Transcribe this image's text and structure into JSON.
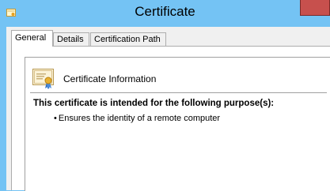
{
  "window": {
    "title": "Certificate",
    "app_icon": "certificate-app-icon",
    "close_icon": "close-icon",
    "colors": {
      "titlebar": "#74c3f4",
      "close": "#c7504d"
    }
  },
  "tabs": [
    {
      "label": "General",
      "active": true
    },
    {
      "label": "Details",
      "active": false
    },
    {
      "label": "Certification Path",
      "active": false
    }
  ],
  "general": {
    "icon": "certificate-icon",
    "info_title": "Certificate Information",
    "purpose_heading": "This certificate is intended for the following purpose(s):",
    "purposes": [
      {
        "bullet": "•",
        "text": "Ensures the identity of a remote computer"
      }
    ]
  }
}
